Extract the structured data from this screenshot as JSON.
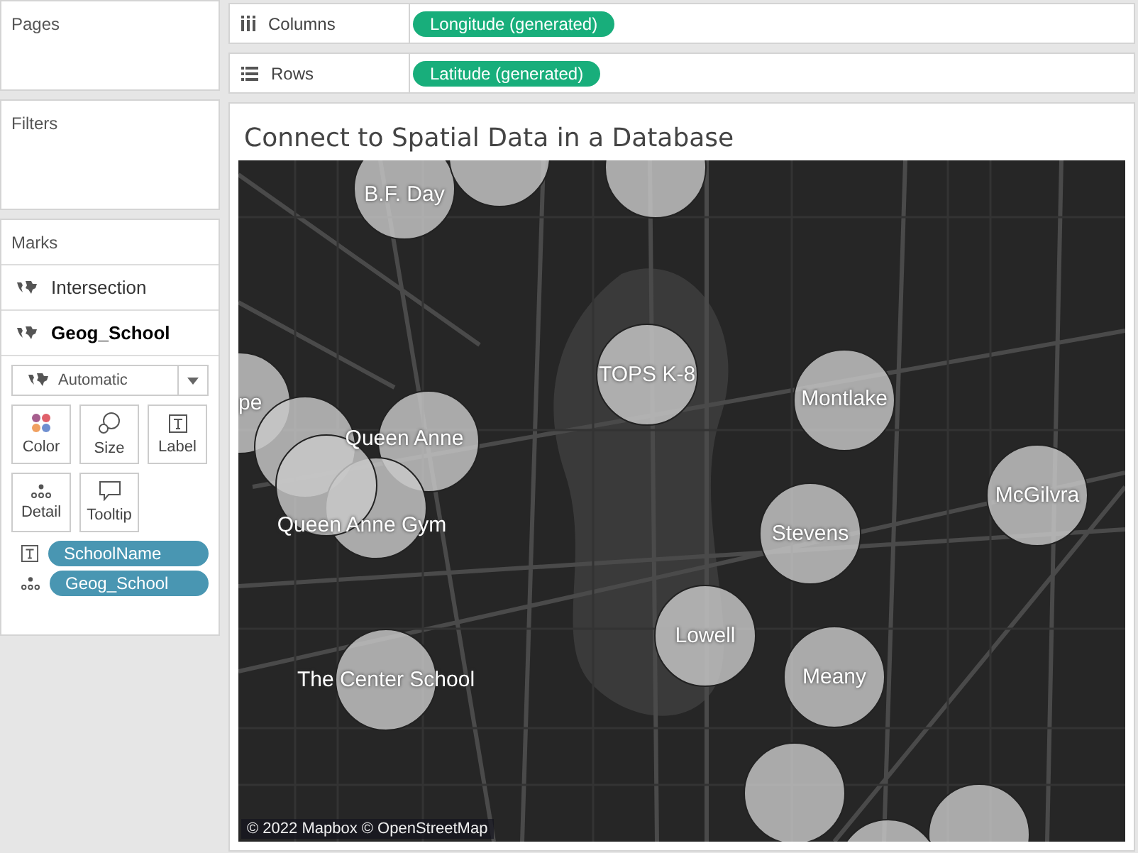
{
  "sidebar": {
    "pages": {
      "title": "Pages"
    },
    "filters": {
      "title": "Filters"
    },
    "marks": {
      "title": "Marks",
      "layers": [
        {
          "label": "Intersection",
          "selected": false
        },
        {
          "label": "Geog_School",
          "selected": true
        }
      ],
      "mark_type": "Automatic",
      "cards": [
        {
          "label": "Color",
          "kind": "color"
        },
        {
          "label": "Size",
          "kind": "size"
        },
        {
          "label": "Label",
          "kind": "label"
        },
        {
          "label": "Detail",
          "kind": "detail"
        },
        {
          "label": "Tooltip",
          "kind": "tooltip"
        }
      ],
      "fields": [
        {
          "label": "SchoolName",
          "kind": "label"
        },
        {
          "label": "Geog_School",
          "kind": "detail"
        }
      ]
    }
  },
  "shelves": [
    {
      "label": "Columns",
      "kind": "columns",
      "pill": "Longitude (generated)"
    },
    {
      "label": "Rows",
      "kind": "rows",
      "pill": "Latitude (generated)"
    }
  ],
  "viz": {
    "title": "Connect to Spatial Data in a Database",
    "map": {
      "labels": [
        "B.F. Day",
        "TOPS K-8",
        "Montlake",
        "pe",
        "Queen Anne",
        "Queen Anne Gym",
        "McGilvra",
        "Stevens",
        "Lowell",
        "The Center School",
        "Meany"
      ],
      "attribution": "© 2022 Mapbox © OpenStreetMap"
    }
  }
}
